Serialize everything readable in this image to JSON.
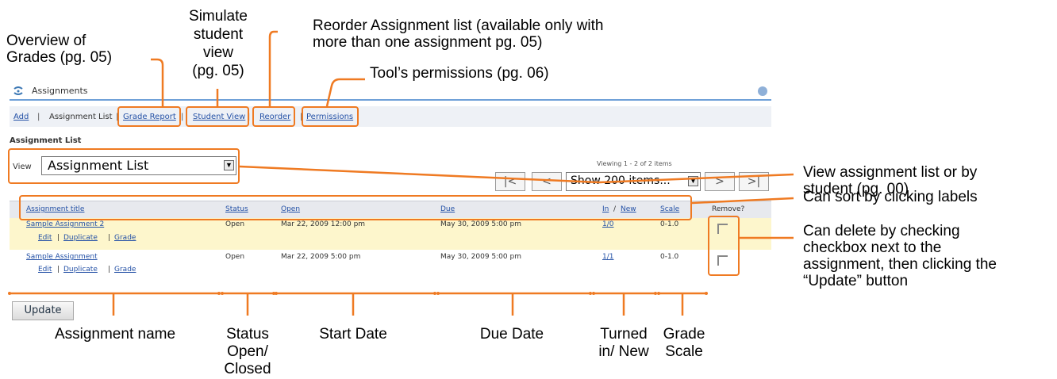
{
  "tool": {
    "title": "Assignments",
    "help_icon": "help-icon",
    "tool_icon": "assignments-icon"
  },
  "nav": {
    "add": "Add",
    "sep1": "|",
    "assignment_list": "Assignment List",
    "sep2": "|",
    "grade_report": "Grade Report",
    "sep3": "|",
    "student_view": "Student View",
    "sep4": "|",
    "reorder": "Reorder",
    "sep5": "|",
    "permissions": "Permissions"
  },
  "section_title": "Assignment List",
  "view": {
    "label": "View",
    "selected": "Assignment List"
  },
  "pager": {
    "viewing": "Viewing 1 - 2 of 2 items",
    "first": "|<",
    "prev": "<",
    "page_size": "Show 200 items...",
    "next": ">",
    "last": ">|"
  },
  "table": {
    "headers": {
      "title": "Assignment title",
      "status": "Status",
      "open": "Open",
      "due": "Due",
      "in": "In",
      "slash": "/",
      "new": "New",
      "scale": "Scale",
      "remove": "Remove?"
    },
    "rows": [
      {
        "title": "Sample Assignment 2",
        "edit": "Edit",
        "duplicate": "Duplicate",
        "grade": "Grade",
        "status": "Open",
        "open": "Mar 22, 2009 12:00 pm",
        "due": "May 30, 2009 5:00 pm",
        "in_new": "1/0",
        "scale": "0-1.0"
      },
      {
        "title": "Sample Assignment",
        "edit": "Edit",
        "duplicate": "Duplicate",
        "grade": "Grade",
        "status": "Open",
        "open": "Mar 22, 2009 5:00 pm",
        "due": "May 30, 2009 5:00 pm",
        "in_new": "1/1",
        "scale": "0-1.0"
      }
    ],
    "sep": "|"
  },
  "update_button": "Update",
  "annotations": {
    "overview_1": "Overview of",
    "overview_2": "Grades (pg. 05)",
    "simulate_1": "Simulate",
    "simulate_2": "student",
    "simulate_3": "view",
    "simulate_4": "(pg. 05)",
    "reorder_1": "Reorder Assignment list (available only with",
    "reorder_2": "more than one assignment pg. 05)",
    "permissions": "Tool’s permissions (pg. 06)",
    "view_1": "View assignment list or by",
    "view_2": "student (pg. 00)",
    "sort": "Can sort by clicking labels",
    "delete_1": "Can delete by checking",
    "delete_2": "checkbox next to the",
    "delete_3": "assignment, then clicking the",
    "delete_4": "“Update” button",
    "name": "Assignment name",
    "status_1": "Status",
    "status_2": "Open/",
    "status_3": "Closed",
    "start": "Start Date",
    "due": "Due Date",
    "turned_1": "Turned",
    "turned_2": "in/ New",
    "grade_1": "Grade",
    "grade_2": "Scale"
  },
  "colors": {
    "annotation_orange": "#ef7a22",
    "link_blue": "#2451a6",
    "header_rule": "#6fa0d8",
    "highlight_row": "#fdf6cc"
  }
}
